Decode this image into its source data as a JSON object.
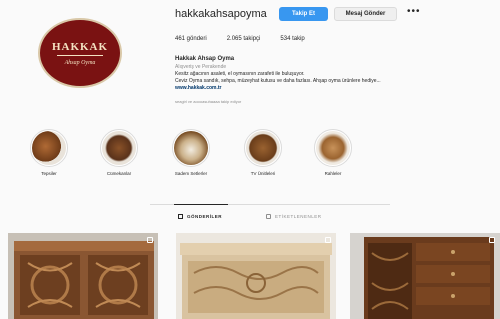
{
  "profile": {
    "logo_text": "HAKKAK",
    "logo_subtext": "Ahsap Oyma",
    "username": "hakkakahsapoyma",
    "follow_label": "Takip Et",
    "message_label": "Mesaj Gönder",
    "posts_count": "461 gönderi",
    "followers_count": "2.065 takipçi",
    "following_count": "534 takip",
    "name": "Hakkak Ahsap Oyma",
    "category": "Alışveriş ve Perakende",
    "bio_line1": "Kesitz ağacının asaleti, el oymasının zarafeti ile buluşuyor.",
    "bio_line2": "Ceviz Oyma sandık, sehpa, müzeyhat kutusu ve daha fazlası. Ahşap oyma ürünlere hediye...",
    "website": "www.hakkak.com.tr",
    "followed_by": "seagirl ve aoooasuhaaaa takip ediyor"
  },
  "highlights": [
    {
      "label": "Tepsiler",
      "color": "#8a4a22"
    },
    {
      "label": "Cümekanlar",
      "color": "#6b3d1c"
    },
    {
      "label": "Sadem Setlerler",
      "color": "#b9915d"
    },
    {
      "label": "TV Ünitleleri",
      "color": "#7a4a1e"
    },
    {
      "label": "Rahleler",
      "color": "#a8743a"
    }
  ],
  "tabs": {
    "posts": "GÖNDERİLER",
    "tagged": "ETİKETLENENLER"
  }
}
